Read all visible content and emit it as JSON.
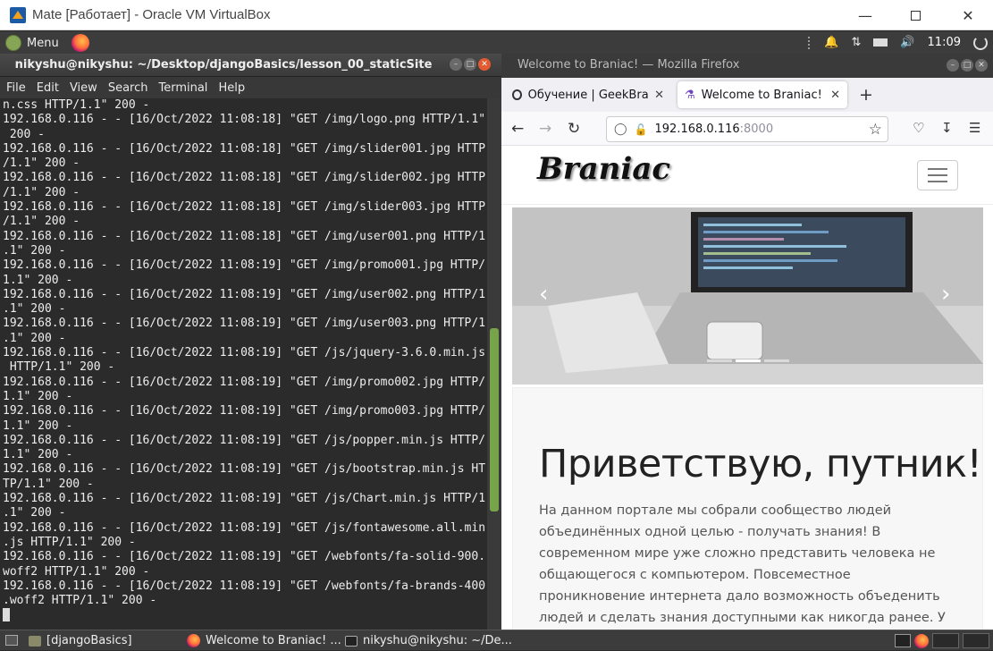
{
  "vbox": {
    "title": "Mate [Работает] - Oracle VM VirtualBox",
    "minimize_icon": "minimize-icon",
    "maximize_icon": "maximize-icon",
    "close_icon": "close-icon"
  },
  "guest_panel": {
    "menu_label": "Menu",
    "clock": "11:09",
    "tray_icons": [
      "bell-icon",
      "network-icon",
      "battery-icon",
      "volume-icon",
      "power-icon"
    ]
  },
  "terminal": {
    "title": "nikyshu@nikyshu: ~/Desktop/djangoBasics/lesson_00_staticSite",
    "menu": [
      "File",
      "Edit",
      "View",
      "Search",
      "Terminal",
      "Help"
    ],
    "lines": [
      "n.css HTTP/1.1\" 200 -",
      "192.168.0.116 - - [16/Oct/2022 11:08:18] \"GET /img/logo.png HTTP/1.1\"",
      " 200 -",
      "192.168.0.116 - - [16/Oct/2022 11:08:18] \"GET /img/slider001.jpg HTTP",
      "/1.1\" 200 -",
      "192.168.0.116 - - [16/Oct/2022 11:08:18] \"GET /img/slider002.jpg HTTP",
      "/1.1\" 200 -",
      "192.168.0.116 - - [16/Oct/2022 11:08:18] \"GET /img/slider003.jpg HTTP",
      "/1.1\" 200 -",
      "192.168.0.116 - - [16/Oct/2022 11:08:18] \"GET /img/user001.png HTTP/1",
      ".1\" 200 -",
      "192.168.0.116 - - [16/Oct/2022 11:08:19] \"GET /img/promo001.jpg HTTP/",
      "1.1\" 200 -",
      "192.168.0.116 - - [16/Oct/2022 11:08:19] \"GET /img/user002.png HTTP/1",
      ".1\" 200 -",
      "192.168.0.116 - - [16/Oct/2022 11:08:19] \"GET /img/user003.png HTTP/1",
      ".1\" 200 -",
      "192.168.0.116 - - [16/Oct/2022 11:08:19] \"GET /js/jquery-3.6.0.min.js",
      " HTTP/1.1\" 200 -",
      "192.168.0.116 - - [16/Oct/2022 11:08:19] \"GET /img/promo002.jpg HTTP/",
      "1.1\" 200 -",
      "192.168.0.116 - - [16/Oct/2022 11:08:19] \"GET /img/promo003.jpg HTTP/",
      "1.1\" 200 -",
      "192.168.0.116 - - [16/Oct/2022 11:08:19] \"GET /js/popper.min.js HTTP/",
      "1.1\" 200 -",
      "192.168.0.116 - - [16/Oct/2022 11:08:19] \"GET /js/bootstrap.min.js HT",
      "TP/1.1\" 200 -",
      "192.168.0.116 - - [16/Oct/2022 11:08:19] \"GET /js/Chart.min.js HTTP/1",
      ".1\" 200 -",
      "192.168.0.116 - - [16/Oct/2022 11:08:19] \"GET /js/fontawesome.all.min",
      ".js HTTP/1.1\" 200 -",
      "192.168.0.116 - - [16/Oct/2022 11:08:19] \"GET /webfonts/fa-solid-900.",
      "woff2 HTTP/1.1\" 200 -",
      "192.168.0.116 - - [16/Oct/2022 11:08:19] \"GET /webfonts/fa-brands-400",
      ".woff2 HTTP/1.1\" 200 -"
    ],
    "scroll_position": 0.66
  },
  "firefox": {
    "window_title": "Welcome to Braniac! — Mozilla Firefox",
    "tabs": [
      {
        "label": "Обучение | GeekBrains -",
        "active": false
      },
      {
        "label": "Welcome to Braniac!",
        "active": true
      }
    ],
    "url_host": "192.168.0.116",
    "url_port": ":8000",
    "page": {
      "brand": "Braniac",
      "heading": "Приветствую, путник!",
      "paragraph": "На данном портале мы собрали сообщество людей объединённых одной целью - получать знания! В современном мире уже сложно представить человека не общающегося с компьютером. Повсеместное проникновение интернета дало возможность объеденить людей и сделать знания доступными как никогда ранее. У тебя есть уникальная возможность получить актуальные знания используя современные"
    }
  },
  "taskbar": {
    "items": [
      "[djangoBasics]",
      "Welcome to Braniac! ...",
      "nikyshu@nikyshu: ~/De..."
    ]
  }
}
